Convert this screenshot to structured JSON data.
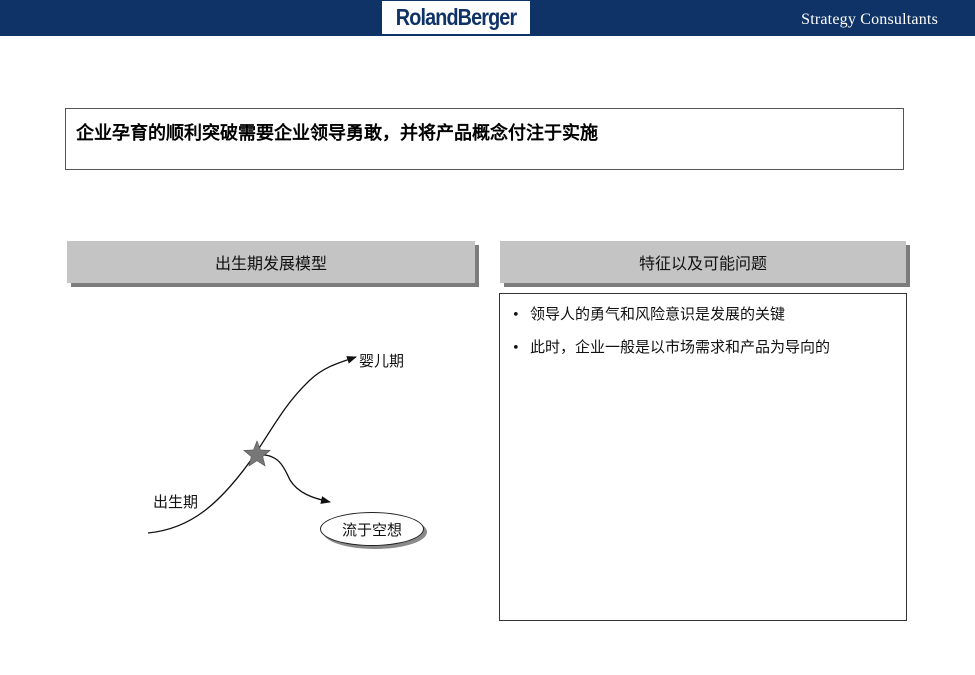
{
  "header": {
    "logo_text": "RolandBerger",
    "tagline": "Strategy Consultants",
    "colors": {
      "band": "#0f3366",
      "logo_bg": "#ffffff"
    }
  },
  "headline": "企业孕育的顺利突破需要企业领导勇敢，并将产品概念付注于实施",
  "left_panel": {
    "title": "出生期发展模型",
    "diagram": {
      "start_label": "出生期",
      "up_label": "婴儿期",
      "down_label": "流于空想",
      "star_icon": "star-icon"
    }
  },
  "right_panel": {
    "title": "特征以及可能问题",
    "bullets": [
      "领导人的勇气和风险意识是发展的关键",
      "此时，企业一般是以市场需求和产品为导向的"
    ]
  },
  "colors": {
    "section_bar": "#c4c4c4",
    "section_shadow": "#7c7c7c",
    "star": "#777777"
  }
}
